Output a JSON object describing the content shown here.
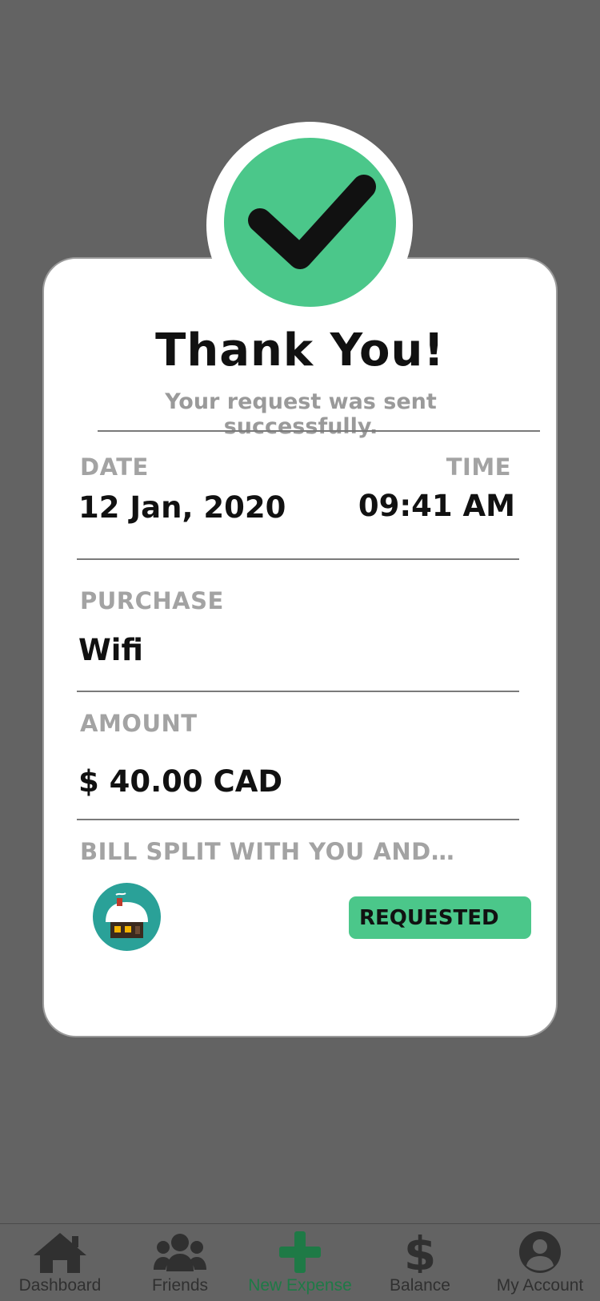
{
  "confirmation": {
    "title": "Thank You!",
    "subtitle": "Your request was sent successfully."
  },
  "details": {
    "date_label": "DATE",
    "date_value": "12 Jan, 2020",
    "time_label": "TIME",
    "time_value": "09:41 AM",
    "purchase_label": "PURCHASE",
    "purchase_value": "Wifi",
    "amount_label": "AMOUNT",
    "amount_value": "$ 40.00 CAD",
    "split_label": "BILL SPLIT WITH YOU AND…"
  },
  "split": {
    "avatar_icon": "house-avatar-icon",
    "status": "REQUESTED"
  },
  "tabs": [
    {
      "label": "Dashboard",
      "icon": "home-icon"
    },
    {
      "label": "Friends",
      "icon": "friends-icon"
    },
    {
      "label": "New Expense",
      "icon": "plus-icon",
      "active": true
    },
    {
      "label": "Balance",
      "icon": "dollar-icon"
    },
    {
      "label": "My Account",
      "icon": "account-icon"
    }
  ],
  "colors": {
    "accent": "#4bc78a",
    "active_tab": "#1e7a46",
    "background": "#636363"
  }
}
